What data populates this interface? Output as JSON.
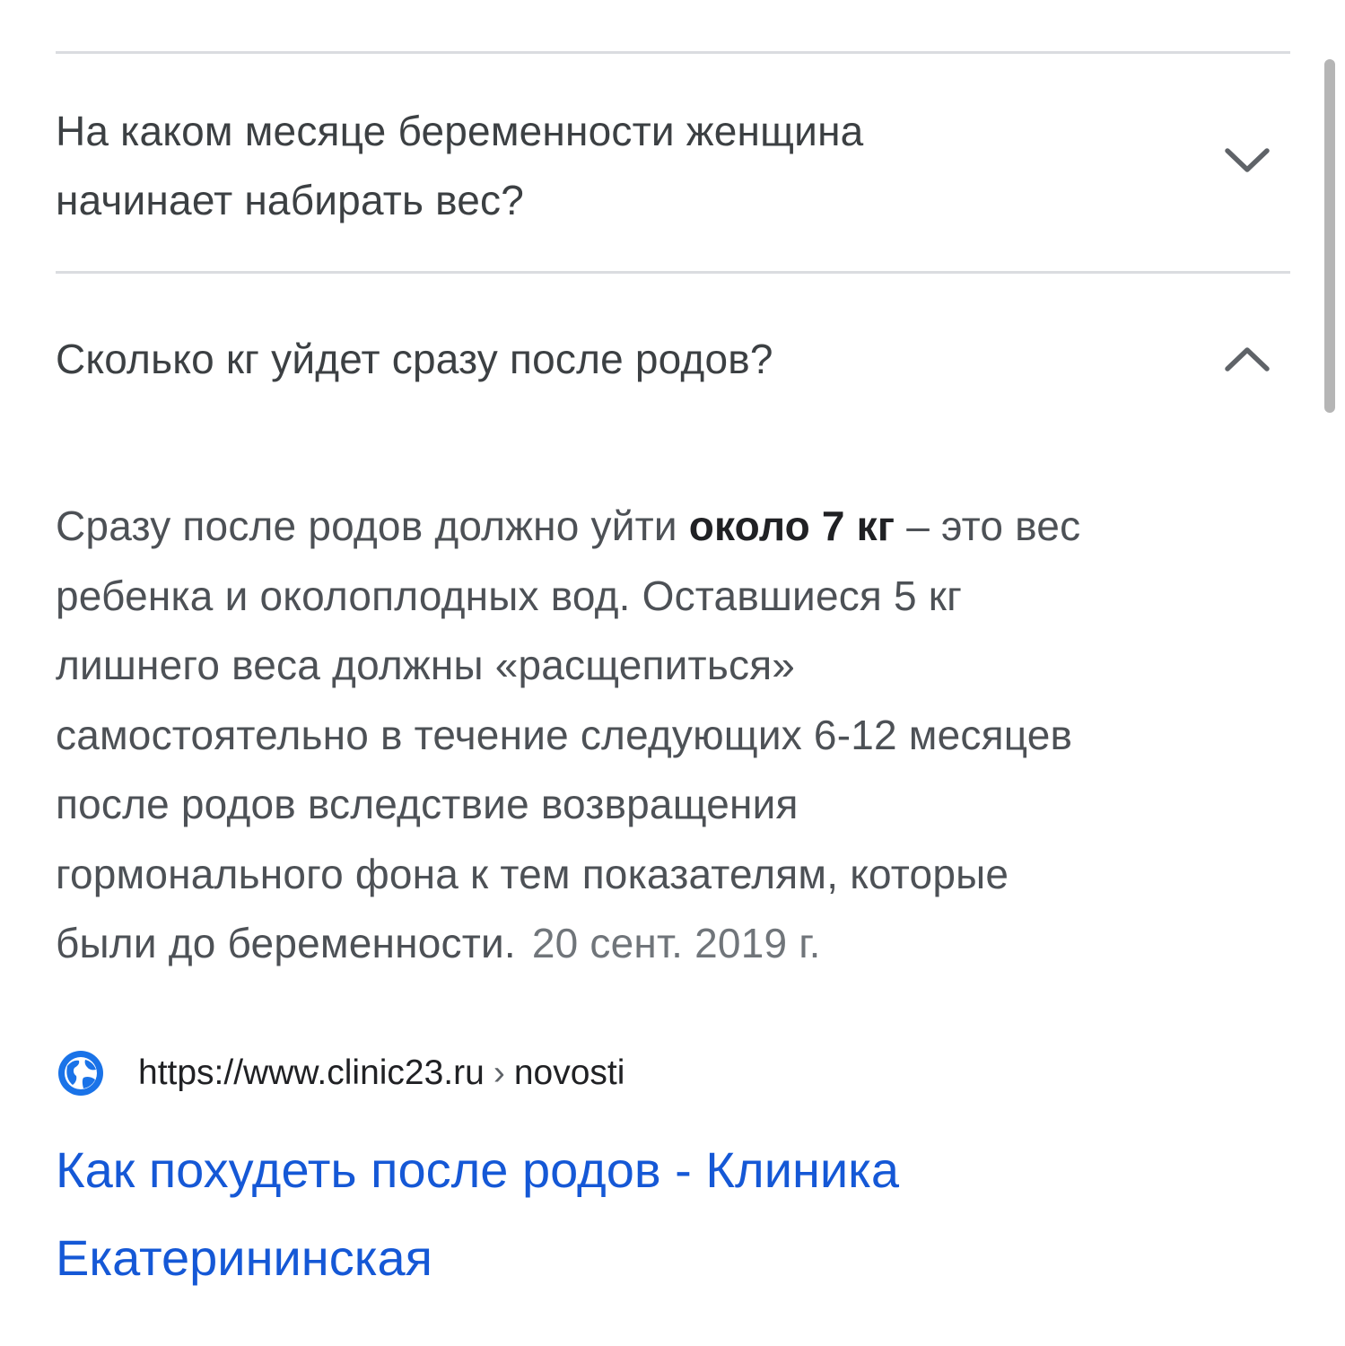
{
  "faq": {
    "q1": {
      "line1": "На каком месяце беременности женщина",
      "line2": "начинает набирать вес?"
    },
    "q2": {
      "text": "Сколько кг уйдет сразу после родов?"
    }
  },
  "answer": {
    "l1_pre": "Сразу после родов должно уйти ",
    "l1_bold": "около 7 кг",
    "l1_post": " – это вес",
    "l2": "ребенка и околоплодных вод. Оставшиеся 5 кг",
    "l3": "лишнего веса должны «расщепиться»",
    "l4": "самостоятельно в течение следующих 6-12 месяцев",
    "l5": "после родов вследствие возвращения",
    "l6": "гормонального фона к тем показателям, которые",
    "l7": "были до беременности.",
    "date": "20 сент. 2019 г."
  },
  "source": {
    "url": "https://www.clinic23.ru",
    "separator": "›",
    "path": "novosti"
  },
  "result": {
    "title_line1": "Как похудеть после родов - Клиника",
    "title_line2": "Екатерининская"
  },
  "colors": {
    "link": "#1558d6",
    "text": "#3c4043",
    "muted": "#70757a",
    "divider": "#dadce0"
  },
  "icons": {
    "q1_toggle": "chevron-down-icon",
    "q2_toggle": "chevron-up-icon",
    "source": "globe-icon"
  }
}
